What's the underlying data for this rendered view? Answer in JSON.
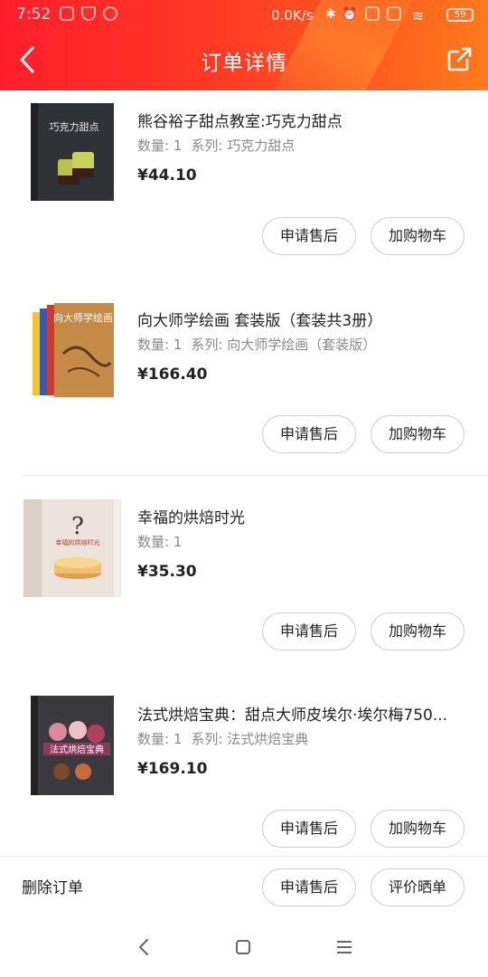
{
  "status_bar": {
    "time": "7:52",
    "net_speed": "0.0K/s",
    "battery": "59"
  },
  "header": {
    "title": "订单详情"
  },
  "items": [
    {
      "name": "熊谷裕子甜点教室:巧克力甜点",
      "qty_label": "数量: 1",
      "series_label": "系列: 巧克力甜点",
      "price": "¥44.10",
      "btn_after": "申请售后",
      "btn_cart": "加购物车",
      "cover_text": "巧克力甜点"
    },
    {
      "name": "向大师学绘画 套装版（套装共3册）",
      "qty_label": "数量: 1",
      "series_label": "系列: 向大师学绘画（套装版）",
      "price": "¥166.40",
      "btn_after": "申请售后",
      "btn_cart": "加购物车",
      "cover_text": "向大师学绘画"
    },
    {
      "name": "幸福的烘焙时光",
      "qty_label": "数量: 1",
      "series_label": "",
      "price": "¥35.30",
      "btn_after": "申请售后",
      "btn_cart": "加购物车",
      "cover_text": "幸福的烘焙时光"
    },
    {
      "name": "法式烘焙宝典：甜点大师皮埃尔·埃尔梅750...",
      "qty_label": "数量: 1",
      "series_label": "系列: 法式烘焙宝典",
      "price": "¥169.10",
      "btn_after": "申请售后",
      "btn_cart": "加购物车",
      "cover_text": "法式烘焙宝典"
    }
  ],
  "footer": {
    "delete_label": "删除订单",
    "after_label": "申请售后",
    "review_label": "评价晒单"
  },
  "colors": {
    "header_start": "#ff1e2a",
    "header_end": "#ff7a1c"
  }
}
